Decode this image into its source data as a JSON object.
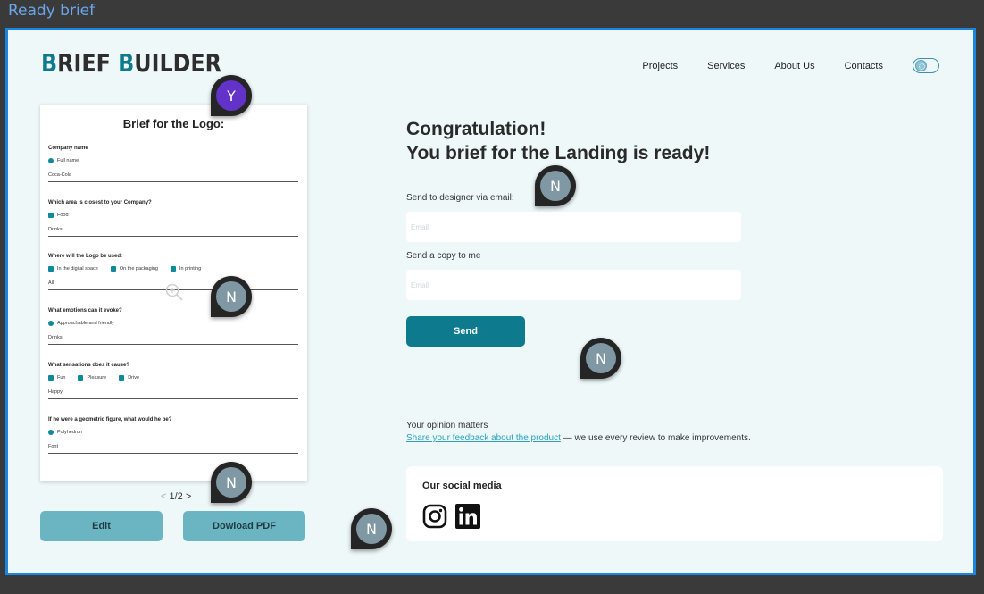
{
  "window": {
    "title": "Ready brief"
  },
  "header": {
    "logo_part1_accent": "B",
    "logo_part1_rest": "RIEF ",
    "logo_part2_accent": "B",
    "logo_part2_rest": "UILDER",
    "nav": [
      "Projects",
      "Services",
      "About Us",
      "Contacts"
    ]
  },
  "brief": {
    "title": "Brief for the Logo:",
    "questions": [
      {
        "label": "Company name",
        "options": [
          "Full name"
        ],
        "value": "Coca-Cola"
      },
      {
        "label": "Which area is closest to your Company?",
        "options": [
          "Food"
        ],
        "value": "Drinks"
      },
      {
        "label": "Where will the Logo be used:",
        "options": [
          "In the digital space",
          "On the packaging",
          "In printing"
        ],
        "value": "All"
      },
      {
        "label": "What emotions can it evoke?",
        "options": [
          "Approachable and friendly"
        ],
        "value": "Drinks"
      },
      {
        "label": "What sensations does it cause?",
        "options": [
          "Fun",
          "Pleasure",
          "Drive"
        ],
        "value": "Happy"
      },
      {
        "label": "If he were a geometric figure, what would he be?",
        "options": [
          "Polyhedron"
        ],
        "value": "Font"
      }
    ],
    "pager": {
      "prev": "<",
      "label": "1/2",
      "next": ">"
    },
    "edit_label": "Edit",
    "download_label": "Dowload PDF"
  },
  "main": {
    "heading_line1": "Congratulation!",
    "heading_line2": "You brief for the Landing is ready!",
    "designer_label": "Send to designer via email:",
    "designer_placeholder": "Email",
    "copy_label": "Send a copy to me",
    "copy_placeholder": "Email",
    "send_label": "Send",
    "opinion_title": "Your opinion matters",
    "opinion_link": "Share your feedback about the product",
    "opinion_rest": " — we use every review to make improvements.",
    "social_title": "Our social media",
    "social_icons": [
      "instagram-icon",
      "linkedin-icon"
    ]
  },
  "collaborators": {
    "pins": [
      "Y",
      "N",
      "N",
      "N",
      "N",
      "N"
    ]
  },
  "colors": {
    "accent": "#0e7a8e",
    "button_light": "#6ab5c1",
    "frame_border": "#1a86e0",
    "page_bg": "#eef8f9",
    "pin_purple": "#6232c9",
    "pin_gray": "#7f98a3"
  }
}
